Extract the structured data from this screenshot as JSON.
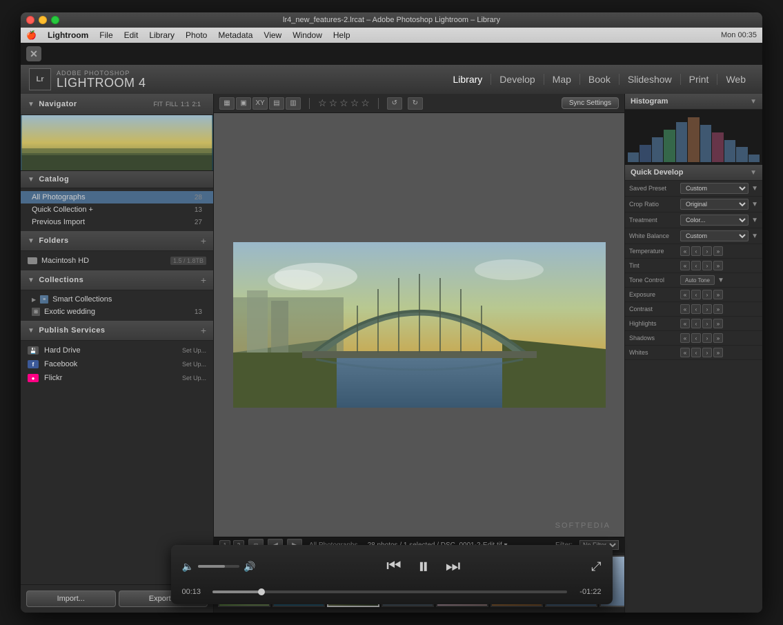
{
  "os": {
    "menubar": {
      "apple": "🍎",
      "items": [
        "Lightroom",
        "File",
        "Edit",
        "Library",
        "Photo",
        "Metadata",
        "View",
        "Window",
        "Help"
      ],
      "right": "Mon 00:35"
    },
    "title": "lr4_new_features-2.lrcat – Adobe Photoshop Lightroom – Library"
  },
  "app": {
    "close_icon": "✕",
    "logo_small": "ADOBE PHOTOSHOP",
    "logo_large": "LIGHTROOM 4",
    "lr_label": "Lr",
    "nav_links": [
      "Library",
      "Develop",
      "Map",
      "Book",
      "Slideshow",
      "Print",
      "Web"
    ]
  },
  "left_panel": {
    "navigator": {
      "title": "Navigator",
      "controls": [
        "FIT",
        "FILL",
        "1:1",
        "2:1"
      ]
    },
    "catalog": {
      "title": "Catalog",
      "items": [
        {
          "label": "All Photographs",
          "count": "28"
        },
        {
          "label": "Quick Collection +",
          "count": "13"
        },
        {
          "label": "Previous Import",
          "count": "27"
        }
      ]
    },
    "folders": {
      "title": "Folders",
      "add_label": "+",
      "items": [
        {
          "label": "Macintosh HD",
          "size": "1.5 / 1.8TB"
        }
      ]
    },
    "collections": {
      "title": "Collections",
      "add_label": "+",
      "items": [
        {
          "label": "Smart Collections",
          "type": "smart"
        },
        {
          "label": "Exotic wedding",
          "count": "13",
          "type": "regular"
        }
      ]
    },
    "publish_services": {
      "title": "Publish Services",
      "add_label": "+",
      "items": [
        {
          "label": "Hard Drive",
          "setup": "Set Up...",
          "type": "hdd"
        },
        {
          "label": "Facebook",
          "setup": "Set Up...",
          "type": "fb"
        },
        {
          "label": "Flickr",
          "setup": "Set Up...",
          "type": "flickr"
        }
      ]
    },
    "buttons": {
      "import": "Import...",
      "export": "Export..."
    }
  },
  "center": {
    "toolbar_views": [
      "▦",
      "▣",
      "XY",
      "▤",
      "▥"
    ],
    "filmstrip_info": "All Photographs",
    "photos_count": "28 photos / 1 selected / DSC_0001-2-Edit.tif ▾",
    "filter_label": "Filter:",
    "filter_value": "No Filter",
    "sync_label": "Sync Settings",
    "stars": [
      "★",
      "★",
      "★",
      "★",
      "★"
    ],
    "photos": [
      {
        "id": 1,
        "class": "photo-1"
      },
      {
        "id": 2,
        "class": "photo-2"
      },
      {
        "id": 3,
        "class": "photo-3",
        "selected": true
      },
      {
        "id": 4,
        "class": "photo-4"
      },
      {
        "id": 5,
        "class": "photo-5"
      },
      {
        "id": 6,
        "class": "photo-6"
      },
      {
        "id": 7,
        "class": "photo-7"
      },
      {
        "id": 8,
        "class": "photo-8"
      },
      {
        "id": 9,
        "class": "photo-9"
      },
      {
        "id": 10,
        "class": "photo-10"
      },
      {
        "id": 11,
        "class": "photo-11"
      }
    ]
  },
  "right_panel": {
    "histogram": {
      "title": "Histogram"
    },
    "quick_develop": {
      "title": "Quick Develop",
      "fields": [
        {
          "label": "Saved Preset",
          "value": "Custom"
        },
        {
          "label": "Crop Ratio",
          "value": "Original"
        },
        {
          "label": "Treatment",
          "value": "Color..."
        }
      ],
      "white_balance_label": "White Balance",
      "white_balance_value": "Custom",
      "tone_label": "Tone Control",
      "tone_value": "Auto Tone",
      "sliders": [
        {
          "label": "Temperature"
        },
        {
          "label": "Tint"
        },
        {
          "label": "Exposure"
        },
        {
          "label": "Contrast"
        },
        {
          "label": "Highlights"
        },
        {
          "label": "Shadows"
        },
        {
          "label": "Whites"
        }
      ]
    },
    "sync_button": "Sync Settings"
  },
  "video_player": {
    "time_current": "00:13",
    "time_remaining": "-01:22",
    "progress_percent": 14,
    "volume_percent": 65
  },
  "watermark": "SOFTPEDIA"
}
